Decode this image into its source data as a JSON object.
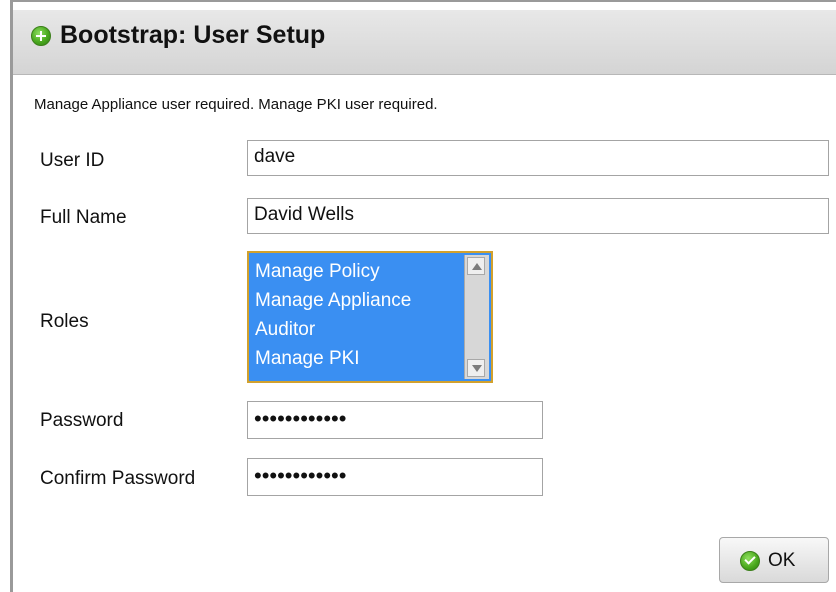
{
  "dialog": {
    "title": "Bootstrap: User Setup",
    "notice": "Manage Appliance user required. Manage PKI user required."
  },
  "form": {
    "user_id_label": "User ID",
    "user_id_value": "dave",
    "full_name_label": "Full Name",
    "full_name_value": "David Wells",
    "roles_label": "Roles",
    "roles": [
      "Manage Policy",
      "Manage Appliance",
      "Auditor",
      "Manage PKI"
    ],
    "password_label": "Password",
    "password_value": "••••••••••••",
    "confirm_password_label": "Confirm Password",
    "confirm_password_value": "••••••••••••"
  },
  "buttons": {
    "ok_label": "OK"
  },
  "colors": {
    "selection": "#3a8ff2",
    "focus_border": "#d2a12d",
    "header": "#d8d8d8"
  },
  "icons": {
    "header": "add-circle-icon",
    "ok": "check-circle-icon"
  }
}
